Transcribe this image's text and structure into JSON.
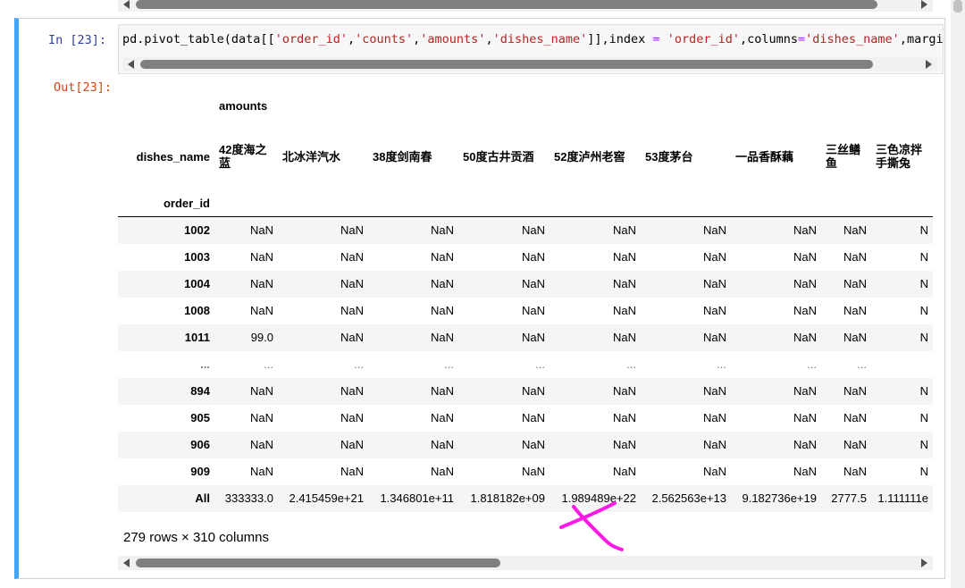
{
  "cell": {
    "in_prompt": "In  [23]:",
    "out_prompt": "Out[23]:",
    "code": {
      "prefix": "pd.pivot_table(data[[",
      "s1": "'order_id'",
      "c1": ",",
      "s2": "'counts'",
      "c2": ",",
      "s3": "'amounts'",
      "c3": ",",
      "s4": "'dishes_name'",
      "mid1": "]],index ",
      "eq1": "=",
      "sp1": " ",
      "s5": "'order_id'",
      "mid2": ",columns",
      "eq2": "=",
      "s6": "'dishes_name'",
      "tail": ",margin"
    }
  },
  "table": {
    "top_header": "amounts",
    "columns_name": "dishes_name",
    "index_name": "order_id",
    "columns": [
      "42度海之蓝",
      "北冰洋汽水",
      "38度剑南春",
      "50度古井贡酒",
      "52度泸州老窖",
      "53度茅台",
      "一品香酥藕",
      "三丝鳝鱼",
      "三色凉拌手撕兔"
    ],
    "rows": [
      {
        "index": "1002",
        "values": [
          "NaN",
          "NaN",
          "NaN",
          "NaN",
          "NaN",
          "NaN",
          "NaN",
          "NaN",
          "N"
        ]
      },
      {
        "index": "1003",
        "values": [
          "NaN",
          "NaN",
          "NaN",
          "NaN",
          "NaN",
          "NaN",
          "NaN",
          "NaN",
          "N"
        ]
      },
      {
        "index": "1004",
        "values": [
          "NaN",
          "NaN",
          "NaN",
          "NaN",
          "NaN",
          "NaN",
          "NaN",
          "NaN",
          "N"
        ]
      },
      {
        "index": "1008",
        "values": [
          "NaN",
          "NaN",
          "NaN",
          "NaN",
          "NaN",
          "NaN",
          "NaN",
          "NaN",
          "N"
        ]
      },
      {
        "index": "1011",
        "values": [
          "99.0",
          "NaN",
          "NaN",
          "NaN",
          "NaN",
          "NaN",
          "NaN",
          "NaN",
          "N"
        ]
      },
      {
        "index": "...",
        "values": [
          "...",
          "...",
          "...",
          "...",
          "...",
          "...",
          "...",
          "...",
          ""
        ]
      },
      {
        "index": "894",
        "values": [
          "NaN",
          "NaN",
          "NaN",
          "NaN",
          "NaN",
          "NaN",
          "NaN",
          "NaN",
          "N"
        ]
      },
      {
        "index": "905",
        "values": [
          "NaN",
          "NaN",
          "NaN",
          "NaN",
          "NaN",
          "NaN",
          "NaN",
          "NaN",
          "N"
        ]
      },
      {
        "index": "906",
        "values": [
          "NaN",
          "NaN",
          "NaN",
          "NaN",
          "NaN",
          "NaN",
          "NaN",
          "NaN",
          "N"
        ]
      },
      {
        "index": "909",
        "values": [
          "NaN",
          "NaN",
          "NaN",
          "NaN",
          "NaN",
          "NaN",
          "NaN",
          "NaN",
          "N"
        ]
      },
      {
        "index": "All",
        "values": [
          "333333.0",
          "2.415459e+21",
          "1.346801e+11",
          "1.818182e+09",
          "1.989489e+22",
          "2.562563e+13",
          "9.182736e+19",
          "2777.5",
          "1.111111e"
        ]
      }
    ],
    "shape_text": "279 rows × 310 columns"
  },
  "colors": {
    "cell_border_accent": "#42a5f5",
    "in_prompt": "#303f9f",
    "out_prompt": "#d84315",
    "string_literal": "#ba2121",
    "operator": "#aa22ff",
    "scribble": "#ff19e6"
  }
}
